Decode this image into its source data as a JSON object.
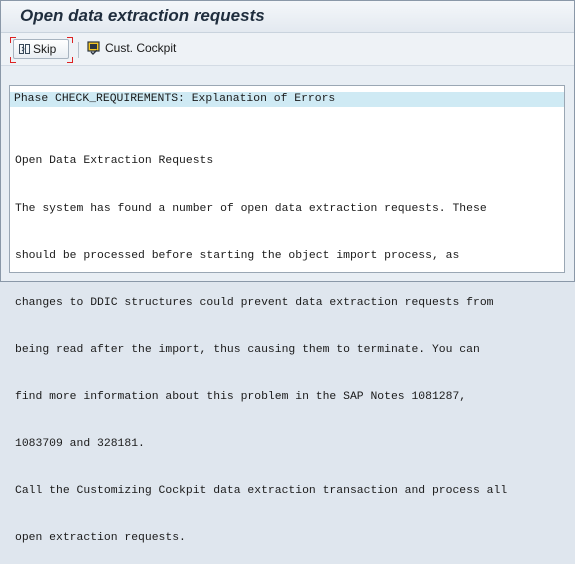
{
  "window": {
    "title": "Open data extraction requests"
  },
  "toolbar": {
    "skip_label": "Skip",
    "cust_cockpit_label": "Cust. Cockpit"
  },
  "content": {
    "phase_line": "Phase CHECK_REQUIREMENTS: Explanation of Errors",
    "heading": "Open Data Extraction Requests",
    "lines": [
      "The system has found a number of open data extraction requests. These",
      "should be processed before starting the object import process, as",
      "changes to DDIC structures could prevent data extraction requests from",
      "being read after the import, thus causing them to terminate. You can",
      "find more information about this problem in the SAP Notes 1081287,",
      "1083709 and 328181.",
      "Call the Customizing Cockpit data extraction transaction and process all",
      "open extraction requests."
    ]
  }
}
